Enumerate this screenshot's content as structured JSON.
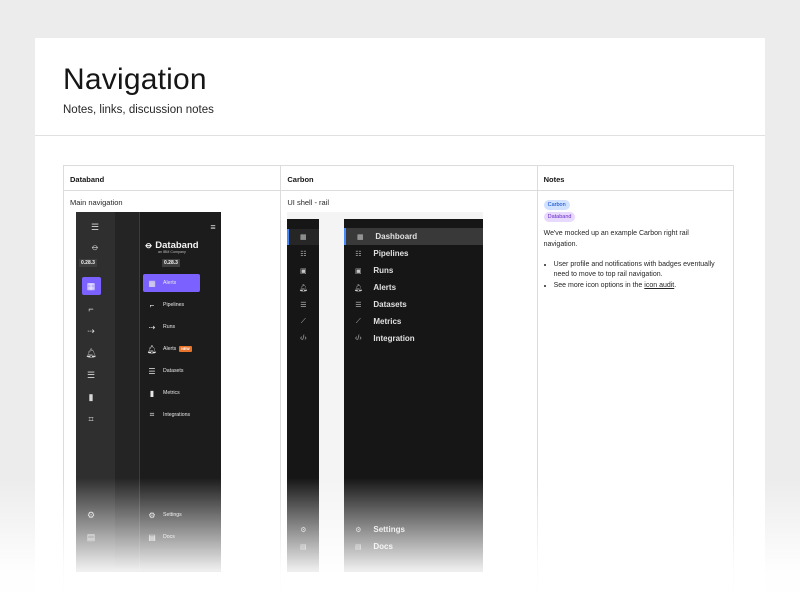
{
  "page": {
    "title": "Navigation",
    "subtitle": "Notes, links, discussion notes"
  },
  "table": {
    "headers": [
      "Databand",
      "Carbon",
      "Notes"
    ],
    "row": {
      "databand_caption": "Main navigation",
      "carbon_caption": "UI shell - rail"
    }
  },
  "databand_mock": {
    "brand": "Databand",
    "brand_sub": "an IBM Company",
    "version": "0.28.3",
    "nav": [
      {
        "label": "Alerts",
        "icon": "dashboard-icon",
        "active": true
      },
      {
        "label": "Pipelines",
        "icon": "pipelines-icon"
      },
      {
        "label": "Runs",
        "icon": "runs-icon"
      },
      {
        "label": "Alerts",
        "icon": "bell-icon",
        "badge": "NEW"
      },
      {
        "label": "Datasets",
        "icon": "database-icon"
      },
      {
        "label": "Metrics",
        "icon": "chart-icon"
      },
      {
        "label": "Integrations",
        "icon": "code-icon"
      }
    ],
    "footer": [
      {
        "label": "Settings",
        "icon": "gear-icon"
      },
      {
        "label": "Docs",
        "icon": "document-icon"
      }
    ],
    "accent": "#7b61ff"
  },
  "carbon_mock": {
    "nav": [
      {
        "label": "Dashboard",
        "icon": "dashboard-icon",
        "active": true
      },
      {
        "label": "Pipelines",
        "icon": "pipelines-icon"
      },
      {
        "label": "Runs",
        "icon": "runs-icon"
      },
      {
        "label": "Alerts",
        "icon": "bell-icon"
      },
      {
        "label": "Datasets",
        "icon": "database-icon"
      },
      {
        "label": "Metrics",
        "icon": "chart-icon"
      },
      {
        "label": "Integration",
        "icon": "code-icon"
      }
    ],
    "footer": [
      {
        "label": "Settings",
        "icon": "gear-icon"
      },
      {
        "label": "Docs",
        "icon": "document-icon"
      }
    ],
    "accent": "#4589ff"
  },
  "notes": {
    "tags": [
      "Carbon",
      "Databand"
    ],
    "paragraph": "We've mocked up an example Carbon right rail navigation.",
    "bullets": [
      "User profile and notifications with badges eventually need to move to top rail navigation.",
      "See more icon options in the"
    ],
    "link_text": "icon audit",
    "link_suffix": "."
  }
}
